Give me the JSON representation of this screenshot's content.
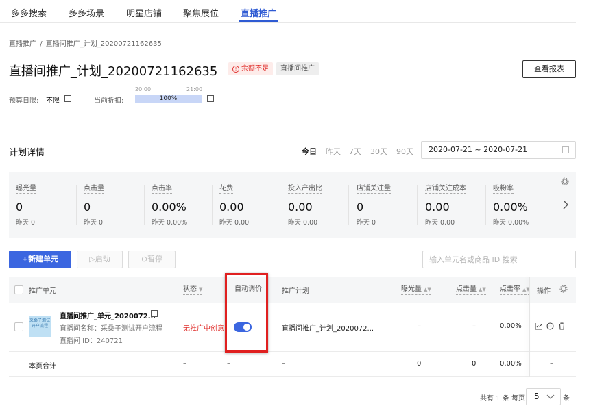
{
  "top_nav": {
    "tabs": [
      "多多搜索",
      "多多场景",
      "明星店铺",
      "聚焦展位",
      "直播推广"
    ],
    "active": "直播推广"
  },
  "breadcrumb": {
    "parent": "直播推广",
    "sep": "/",
    "current": "直播间推广_计划_20200721162635"
  },
  "header": {
    "title": "直播间推广_计划_20200721162635",
    "warning_badge": "余额不足",
    "tag_badge": "直播间推广",
    "report_button": "查看报表"
  },
  "budget": {
    "daily_label": "预算日限:",
    "daily_value": "不限",
    "discount_label": "当前折扣:",
    "time_start": "20:00",
    "time_end": "21:00",
    "discount_value": "100%",
    "discount_fill": 1.0
  },
  "plan_details": {
    "title": "计划详情",
    "ranges": [
      "今日",
      "昨天",
      "7天",
      "30天",
      "90天"
    ],
    "active_range": "今日",
    "date_range": "2020-07-21 ~ 2020-07-21"
  },
  "metrics": [
    {
      "label": "曝光量",
      "value": "0",
      "yesterday": "昨天 0"
    },
    {
      "label": "点击量",
      "value": "0",
      "yesterday": "昨天 0"
    },
    {
      "label": "点击率",
      "value": "0.00%",
      "yesterday": "昨天 0.00%"
    },
    {
      "label": "花费",
      "value": "0.00",
      "yesterday": "昨天 0.00"
    },
    {
      "label": "投入产出比",
      "value": "0.00",
      "yesterday": "昨天 0.00"
    },
    {
      "label": "店铺关注量",
      "value": "0",
      "yesterday": "昨天 0"
    },
    {
      "label": "店铺关注成本",
      "value": "0.00",
      "yesterday": "昨天 0.00"
    },
    {
      "label": "吸粉率",
      "value": "0.00%",
      "yesterday": "昨天 0.00%"
    }
  ],
  "toolbar": {
    "new_unit": "+新建单元",
    "start": "启动",
    "pause": "暂停",
    "search_placeholder": "输入单元名或商品 ID 搜索"
  },
  "table": {
    "headers": {
      "unit": "推广单元",
      "status": "状态",
      "auto_bid": "自动调价",
      "plan": "推广计划",
      "impressions": "曝光量",
      "clicks": "点击量",
      "ctr": "点击率",
      "ops": "操作"
    },
    "rows": [
      {
        "unit_name": "直播间推广_单元_2020072...",
        "room_name": "直播间名称：采桑子测试开户流程",
        "room_id": "直播间 ID：240721",
        "thumb_text": "采桑子测试开户流程",
        "status": "无推广中创意",
        "auto_bid_on": true,
        "plan": "直播间推广_计划_2020072...",
        "impressions": "–",
        "clicks": "–",
        "ctr": "0.00%"
      }
    ],
    "summary": {
      "label": "本页合计",
      "status": "–",
      "auto_bid": "–",
      "plan": "–",
      "impressions": "0",
      "clicks": "0",
      "ctr": "0.00%",
      "ops": "–"
    }
  },
  "pagination": {
    "total": "共有 1 条",
    "per_page_label": "每页",
    "per_page_value": "5",
    "unit": "条"
  },
  "colors": {
    "primary": "#3b66e0",
    "warning": "#e0302d",
    "highlight_box": "#e02020"
  }
}
